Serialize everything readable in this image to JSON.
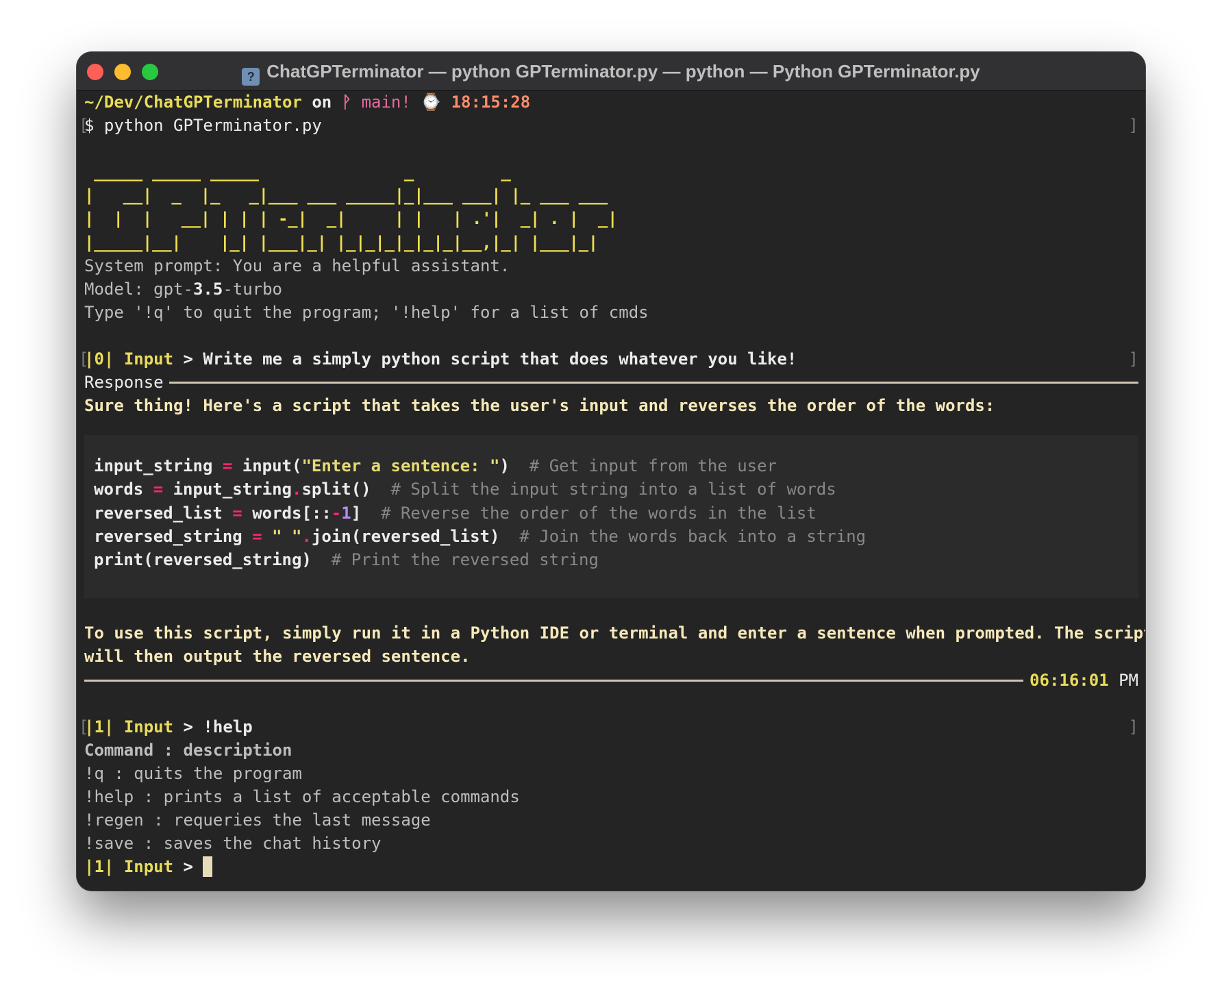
{
  "window": {
    "title": "ChatGPTerminator — python GPTerminator.py — python — Python GPTerminator.py",
    "title_icon": "script-file-icon"
  },
  "prompt_line": {
    "path": "~/Dev/ChatGPTerminator",
    "on": "on",
    "branch_icon": "git-branch-icon",
    "branch": "main!",
    "clock_icon": "watch-icon",
    "time": "18:15:28"
  },
  "command_line": "$ python GPTerminator.py",
  "ascii_banner": [
    " _____ _____ _____               _         _",
    "|   __|  _  |_   _|___ ___ _____|_|___ ___| |_ ___ ___",
    "|  |  |   __| | | | -_|  _|     | |   | .'|  _| . |  _|",
    "|_____|__|    |_| |___|_| |_|_|_|_|_|_|__,|_| |___|_|"
  ],
  "info": {
    "system_prompt": "System prompt: You are a helpful assistant.",
    "model_label": "Model: gpt-",
    "model_version": "3.5",
    "model_suffix": "-turbo",
    "help_hint": "Type '!q' to quit the program; '!help' for a list of cmds"
  },
  "turn0": {
    "prefix": "|0|",
    "input_label": "Input",
    "arrow": ">",
    "user_text": "Write me a simply python script that does whatever you like!",
    "response_label": "Response",
    "response_intro": "Sure thing! Here's a script that takes the user's input and reverses the order of the words:",
    "code": {
      "l1_var": "input_string",
      "l1_eq": "=",
      "l1_call": "input(",
      "l1_str": "\"Enter a sentence: \"",
      "l1_close": ")",
      "l1_comment": "# Get input from the user",
      "l2_var": "words",
      "l2_eq": "=",
      "l2_obj": "input_string",
      "l2_dot": ".",
      "l2_call": "split()",
      "l2_comment": "# Split the input string into a list of words",
      "l3_var": "reversed_list",
      "l3_eq": "=",
      "l3_obj": "words[::",
      "l3_minus": "-",
      "l3_num": "1",
      "l3_close": "]",
      "l3_comment": "# Reverse the order of the words in the list",
      "l4_var": "reversed_string",
      "l4_eq": "=",
      "l4_str": "\" \"",
      "l4_dot": ".",
      "l4_call": "join(reversed_list)",
      "l4_comment": "# Join the words back into a string",
      "l5_call": "print(reversed_string)",
      "l5_comment": "# Print the reversed string"
    },
    "outro_1": "To use this script, simply run it in a Python IDE or terminal and enter a sentence when prompted. The script",
    "outro_2": "will then output the reversed sentence.",
    "timestamp": "06:16:01",
    "ampm": "PM"
  },
  "turn1": {
    "prefix": "|1|",
    "input_label": "Input",
    "arrow": ">",
    "user_text": "!help",
    "help_header": "Command : description",
    "help_items": [
      "!q : quits the program",
      "!help : prints a list of acceptable commands",
      "!regen : requeries the last message",
      "!save : saves the chat history"
    ]
  },
  "current_prompt": {
    "prefix": "|1|",
    "input_label": "Input",
    "arrow": ">"
  }
}
